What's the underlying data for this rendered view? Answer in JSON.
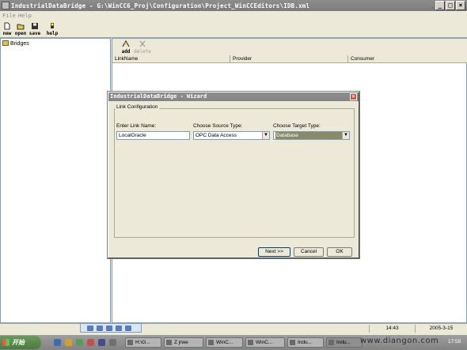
{
  "window": {
    "title": "IndustrialDataBridge - G:\\WinCC6_Proj\\Configuration\\Project_WinCCEditors\\IDB.xml"
  },
  "menu": {
    "items": [
      "File",
      "Help"
    ]
  },
  "toolbar": {
    "buttons": [
      "new",
      "open",
      "save",
      "help"
    ]
  },
  "tree": {
    "root": "Bridges"
  },
  "right_toolbar": {
    "add": "add",
    "delete": "delete"
  },
  "list": {
    "columns": [
      "LinkName",
      "Provider",
      "Consumer"
    ]
  },
  "dialog": {
    "title": "IndustrialDataBridge - Wizard",
    "group_label": "Link Configuration",
    "link_name_label": "Enter Link Name:",
    "link_name_value": "LocalOracle",
    "source_label": "Choose Source Type:",
    "source_value": "OPC Data Access",
    "target_label": "Choose Target Type:",
    "target_value": "Database",
    "buttons": {
      "next": "Next >>",
      "cancel": "Cancel",
      "ok": "OK"
    }
  },
  "status": {
    "time": "14:43",
    "date": "2005-3-15"
  },
  "taskbar": {
    "start": "开始",
    "tasks": [
      "H:\\G...",
      "Z jrwe",
      "WinC...",
      "WinC...",
      "Indu...",
      "Indu..."
    ],
    "clock": "17:59"
  },
  "watermark": "www.diangon.com",
  "colors": {
    "title_gray": "#8e8e8e",
    "combo_selected": "#8a8a6a",
    "window_bg": "#ece9d8"
  }
}
